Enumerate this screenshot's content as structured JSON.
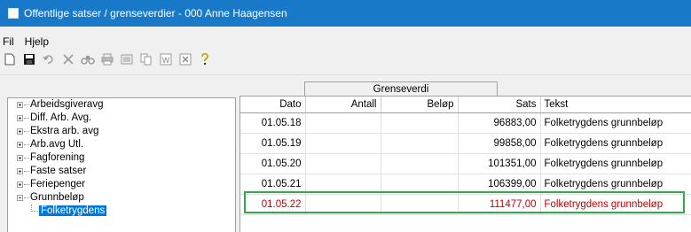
{
  "window": {
    "title": "Offentlige satser / grenseverdier - 000 Anne Haagensen"
  },
  "menu": {
    "items": [
      "Fil",
      "Hjelp"
    ]
  },
  "toolbar": {
    "buttons": [
      "new-icon",
      "save-icon",
      "undo-icon",
      "delete-icon",
      "find-icon",
      "print-icon",
      "preview-icon",
      "copy-icon",
      "word-icon",
      "excel-icon",
      "help-icon"
    ]
  },
  "tree": {
    "items": [
      {
        "label": "Arbeidsgiveravg",
        "expanded": false
      },
      {
        "label": "Diff. Arb. Avg.",
        "expanded": false
      },
      {
        "label": "Ekstra arb. avg",
        "expanded": false
      },
      {
        "label": "Arb.avg Utl.",
        "expanded": false
      },
      {
        "label": "Fagforening",
        "expanded": false
      },
      {
        "label": "Faste satser",
        "expanded": false
      },
      {
        "label": "Feriepenger",
        "expanded": false
      },
      {
        "label": "Grunnbeløp",
        "expanded": true
      }
    ],
    "child": {
      "label": "Folketrygdens",
      "selected": true
    }
  },
  "grid": {
    "group_header": "Grenseverdi",
    "columns": [
      "Dato",
      "Antall",
      "Beløp",
      "Sats",
      "Tekst"
    ],
    "rows": [
      {
        "dato": "01.05.18",
        "antall": "",
        "belop": "",
        "sats": "96883,00",
        "tekst": "Folketrygdens grunnbeløp"
      },
      {
        "dato": "01.05.19",
        "antall": "",
        "belop": "",
        "sats": "99858,00",
        "tekst": "Folketrygdens grunnbeløp"
      },
      {
        "dato": "01.05.20",
        "antall": "",
        "belop": "",
        "sats": "101351,00",
        "tekst": "Folketrygdens grunnbeløp"
      },
      {
        "dato": "01.05.21",
        "antall": "",
        "belop": "",
        "sats": "106399,00",
        "tekst": "Folketrygdens grunnbeløp"
      },
      {
        "dato": "01.05.22",
        "antall": "",
        "belop": "",
        "sats": "111477,00",
        "tekst": "Folketrygdens grunnbeløp"
      }
    ]
  },
  "colors": {
    "titlebar": "#1979c9",
    "highlight_row_text": "#c00000",
    "highlight_box": "#2eaa4a",
    "selection": "#0078d7"
  }
}
